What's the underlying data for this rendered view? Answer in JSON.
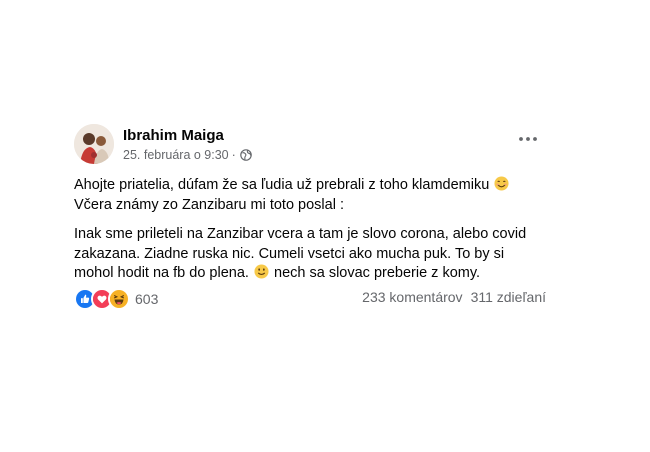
{
  "post": {
    "author": "Ibrahim Maiga",
    "date": "25. februára o 9:30",
    "separator": "·",
    "privacy_icon": "globe-icon",
    "more_icon": "more-options-icon",
    "paragraph1_line1": "Ahojte priatelia, dúfam že sa ľudia už prebrali z toho klamdemiku",
    "paragraph1_line2": "Včera známy zo Zanzibaru mi toto poslal :",
    "paragraph2_text": "Inak sme prileteli na Zanzibar vcera a tam je slovo corona, alebo covid zakazana. Ziadne ruska nic. Cumeli vsetci ako mucha puk. To by si mohol hodit na fb do plena.",
    "paragraph2_tail": "nech sa slovac preberie z komy.",
    "emoji1": "smiling-face-icon",
    "emoji2": "slightly-smiling-face-icon"
  },
  "stats": {
    "reaction_icons": [
      "like-icon",
      "love-icon",
      "haha-icon"
    ],
    "reaction_count": "603",
    "comments": "233 komentárov",
    "shares": "311 zdieľaní"
  },
  "colors": {
    "like": "#1877f2",
    "love": "#f33e58",
    "haha": "#f7b125",
    "secondary_text": "#65676b"
  }
}
